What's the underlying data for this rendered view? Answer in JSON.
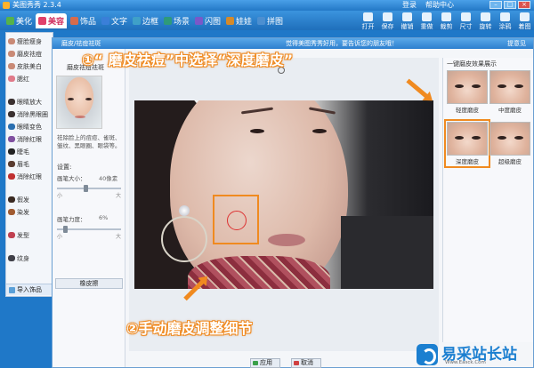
{
  "app": {
    "title": "美图秀秀 2.3.4",
    "top_links": [
      "登录",
      "帮助中心"
    ]
  },
  "tabs": [
    {
      "label": "美化",
      "color": "#56b24a"
    },
    {
      "label": "美容",
      "color": "#e0406a",
      "active": true
    },
    {
      "label": "饰品",
      "color": "#d76b4b"
    },
    {
      "label": "文字",
      "color": "#3a7fd8"
    },
    {
      "label": "边框",
      "color": "#3fa0c8"
    },
    {
      "label": "场景",
      "color": "#2e9a7a"
    },
    {
      "label": "闪图",
      "color": "#7a58c8"
    },
    {
      "label": "娃娃",
      "color": "#d48a2a"
    },
    {
      "label": "拼图",
      "color": "#4c8fd0"
    }
  ],
  "toolbar": [
    "打开",
    "保存",
    "撤销",
    "重做",
    "裁剪",
    "尺寸",
    "旋转",
    "涂鸦",
    "着图"
  ],
  "left_menu": [
    "瘦脸瘦身",
    "磨皮祛痘",
    "皮肤美白",
    "腮红",
    "眼睛放大",
    "消除黑眼圈",
    "眼睛变色",
    "睫毛",
    "眉毛",
    "染发",
    "纹身",
    "假发",
    "发型",
    "消除红眼"
  ],
  "left_import": "导入饰品",
  "dialog": {
    "title": "磨皮/祛痘祛斑",
    "message": "觉得美图秀秀好用，要告诉您的朋友哦！",
    "help": "提意见",
    "panel_title": "磨皮祛痘祛斑",
    "description": "祛除脸上的痘痘、雀斑、皱纹、黑眼圈、眼袋等。",
    "settings_label": "设置:",
    "brush_size_label": "画笔大小：",
    "brush_size_value": "40像素",
    "brush_strength_label": "画笔力度：",
    "brush_strength_value": "6%",
    "min_label": "小",
    "max_label": "大",
    "eraser_label": "橡皮擦",
    "apply_label": "应用",
    "cancel_label": "取消",
    "presets_title": "一键磨皮效果展示",
    "presets": [
      "轻度磨皮",
      "中度磨皮",
      "深度磨皮",
      "超级磨皮"
    ],
    "selected_preset": "深度磨皮",
    "brush_size_level": 0.45,
    "brush_strength_level": 0.1
  },
  "annotations": {
    "step1": "①“ 磨皮祛痘”中选择“深度磨皮”",
    "step2": "②手动磨皮调整细节"
  },
  "watermark": {
    "name": "易采站长站",
    "url": "Www.Easck.Com"
  }
}
